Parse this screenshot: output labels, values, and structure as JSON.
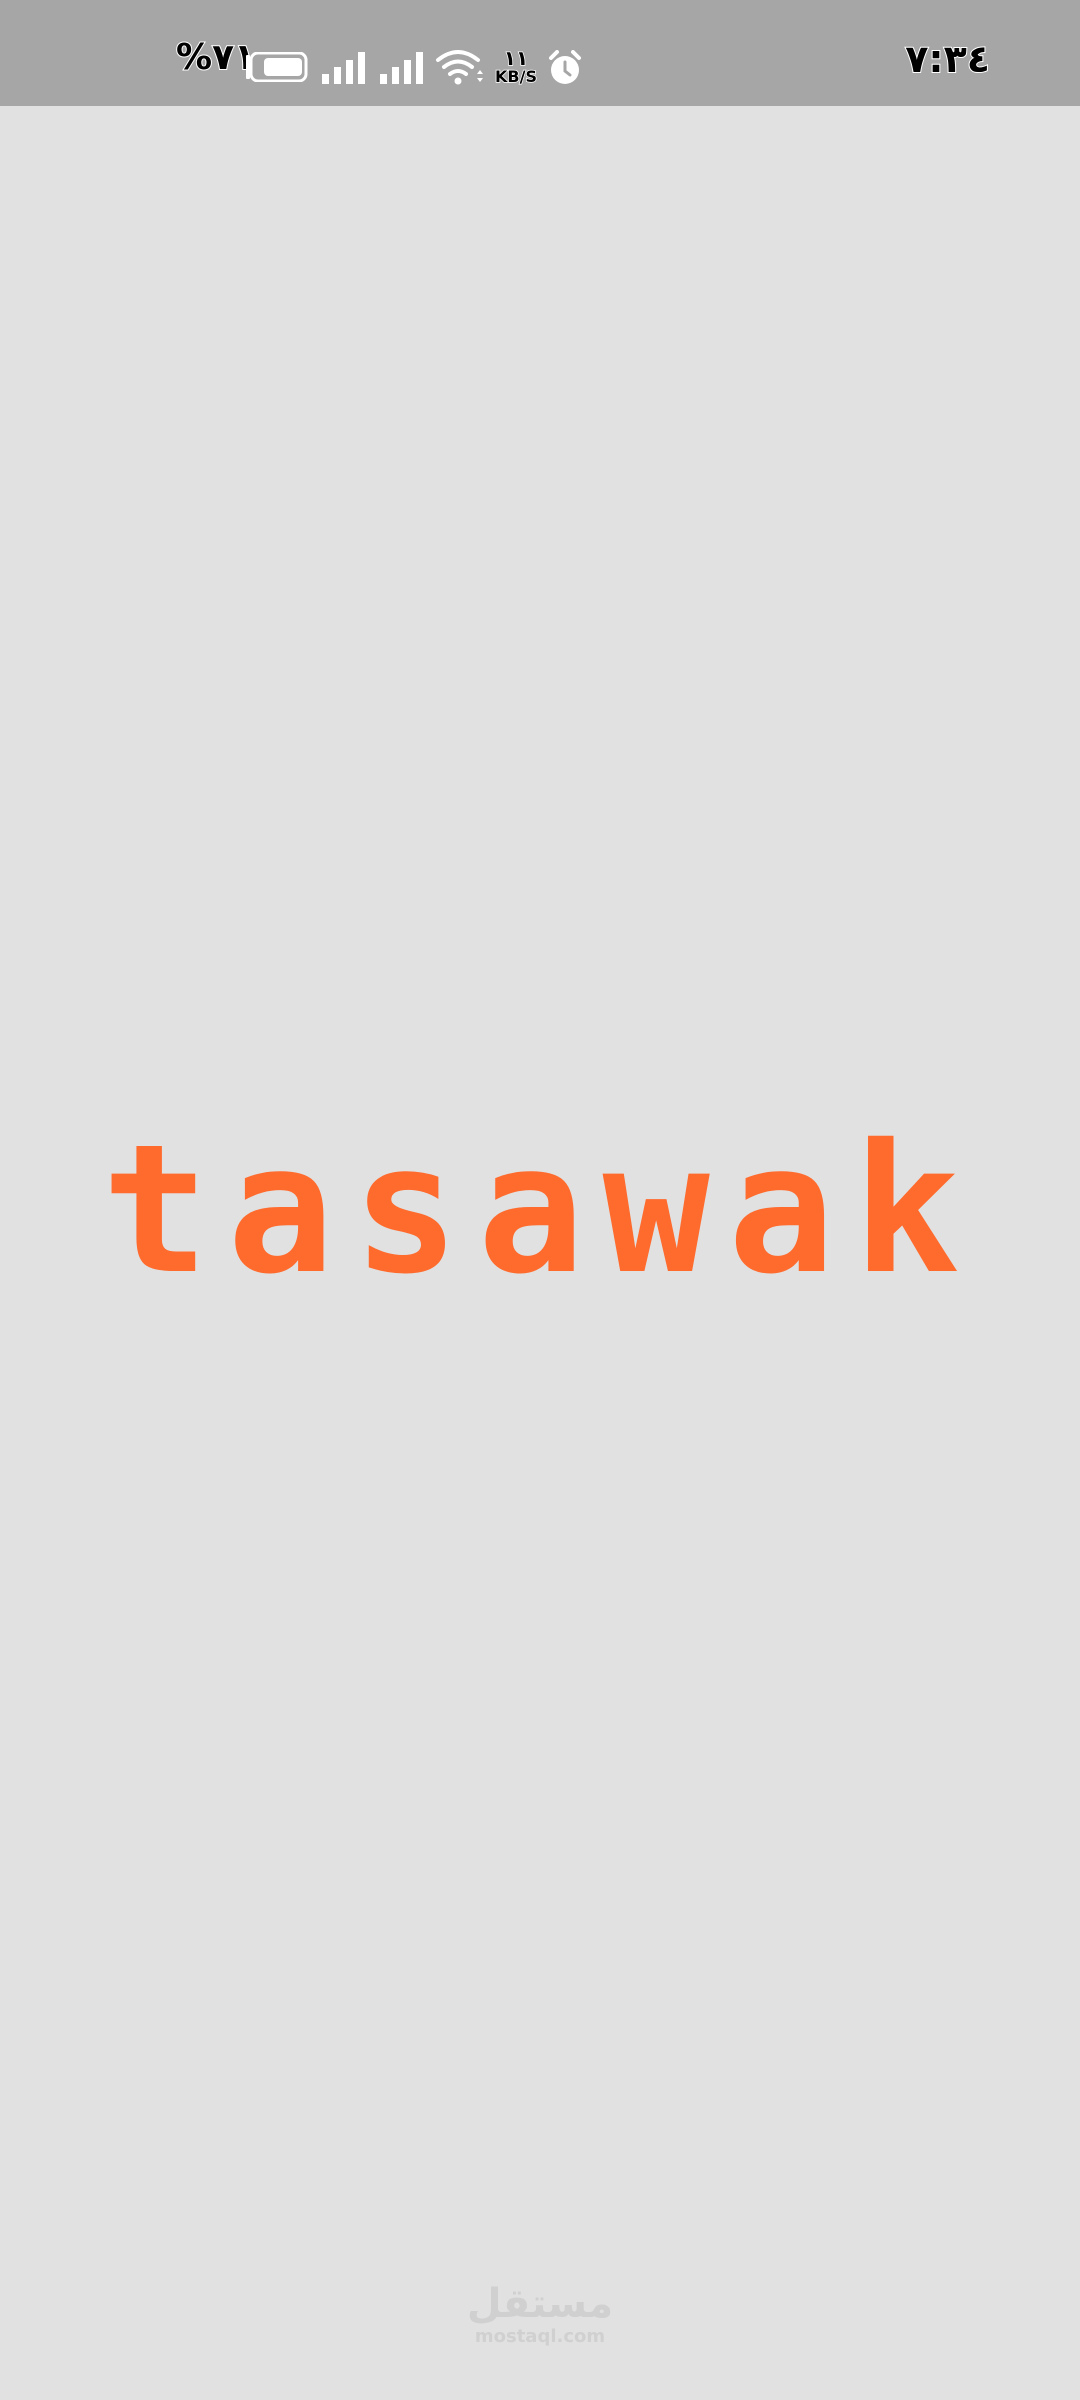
{
  "status_bar": {
    "battery_percent": "%٧١",
    "clock": "٧:٣٤",
    "net_speed_value": "١١",
    "net_speed_unit": "KB/S",
    "icons": [
      "battery-icon",
      "signal-icon",
      "signal-icon",
      "wifi-icon",
      "alarm-icon"
    ],
    "background": "#a6a6a6"
  },
  "splash": {
    "logo_text": "tasawak",
    "logo_color": "#ff6a2d",
    "background": "#e1e1e1"
  },
  "watermark": {
    "arabic": "مستقل",
    "latin": "mostaql.com"
  }
}
